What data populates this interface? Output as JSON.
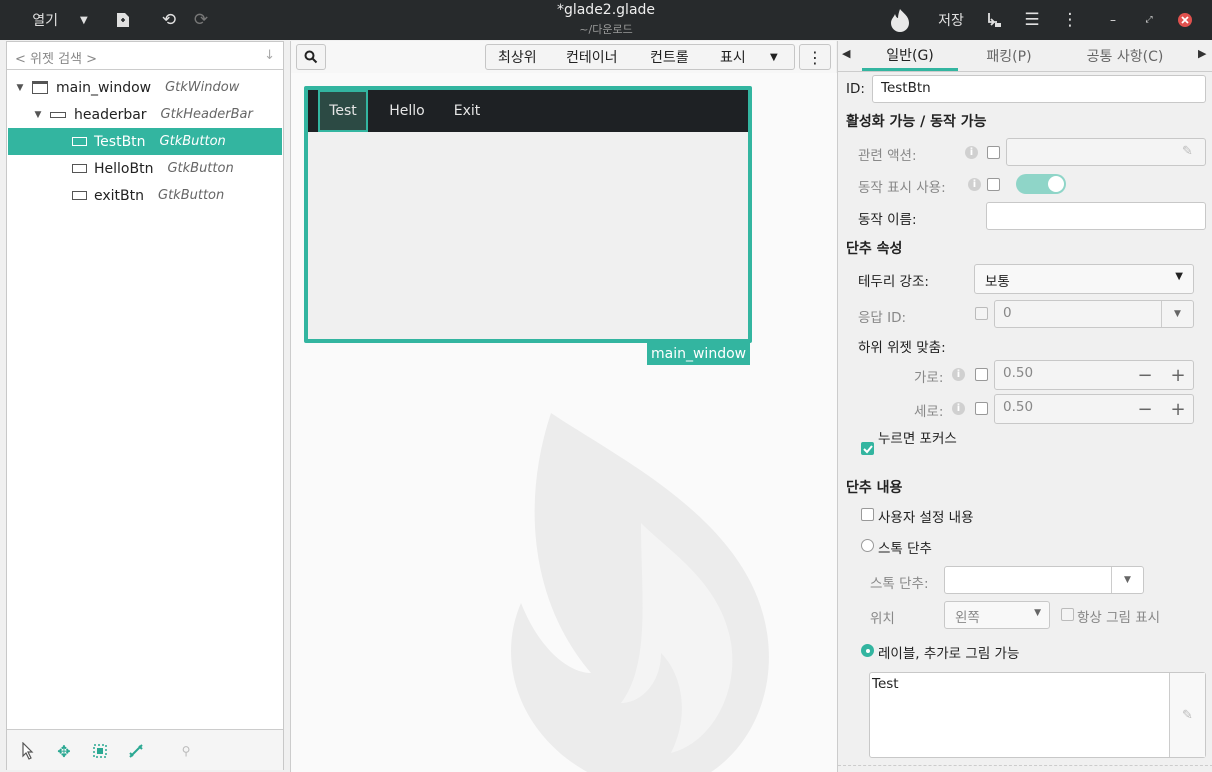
{
  "titlebar": {
    "open_label": "열기",
    "title": "*glade2.glade",
    "subtitle": "~/다운로드",
    "save_label": "저장"
  },
  "left": {
    "search_placeholder": "< 위젯 검색 >",
    "tree": [
      {
        "name": "main_window",
        "type": "GtkWindow"
      },
      {
        "name": "headerbar",
        "type": "GtkHeaderBar"
      },
      {
        "name": "TestBtn",
        "type": "GtkButton"
      },
      {
        "name": "HelloBtn",
        "type": "GtkButton"
      },
      {
        "name": "exitBtn",
        "type": "GtkButton"
      }
    ]
  },
  "center": {
    "toolbar": [
      "최상위",
      "컨테이너",
      "컨트롤",
      "표시"
    ],
    "headerbar_buttons": [
      "Test",
      "Hello",
      "Exit"
    ],
    "window_label": "main_window"
  },
  "right": {
    "tabs": [
      "일반(G)",
      "패킹(P)",
      "공통 사항(C)"
    ],
    "id_label": "ID:",
    "id_value": "TestBtn",
    "sec_activatable": "활성화 가능 / 동작 가능",
    "related_action": "관련 액션:",
    "use_action_appearance": "동작 표시 사용:",
    "action_name": "동작 이름:",
    "sec_button_attrs": "단추 속성",
    "relief_label": "테두리 강조:",
    "relief_value": "보통",
    "response_label": "응답 ID:",
    "response_value": "0",
    "child_align": "하위 위젯 맞춤:",
    "xalign_label": "가로:",
    "xalign_value": "0.50",
    "yalign_label": "세로:",
    "yalign_value": "0.50",
    "focus_on_click": "누르면 포커스",
    "sec_button_content": "단추 내용",
    "custom_content": "사용자 설정 내용",
    "stock_button": "스톡 단추",
    "stock_button_field": "스톡 단추:",
    "position_label": "위치",
    "position_value": "왼쪽",
    "always_show_image": "항상 그림 표시",
    "label_option": "레이블, 추가로 그림 가능",
    "label_text": "Test"
  },
  "colors": {
    "accent": "#33b5a0",
    "titlebar": "#272a2c"
  }
}
